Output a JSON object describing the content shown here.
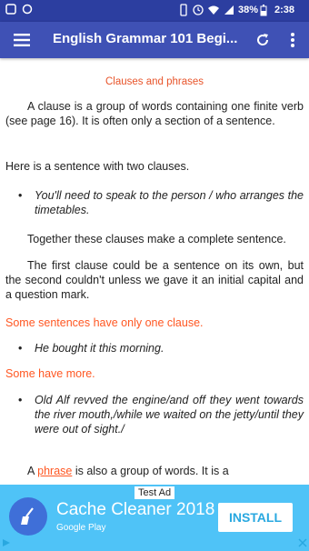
{
  "status_bar": {
    "battery": "38%",
    "time": "2:38"
  },
  "app_bar": {
    "title": "English Grammar 101 Begi..."
  },
  "content": {
    "heading": "Clauses and phrases",
    "para1": "A clause is a group of words containing one finite verb (see page 16). It is often only a section of a sentence.",
    "para2": "Here is a sentence with two clauses.",
    "bullet1": "You'll need to speak to the person / who arranges the timetables.",
    "para3": "Together these clauses make a complete sentence.",
    "para4": "The first clause could be a sentence on its own, but the second couldn't unless we gave it an initial capital and a question mark.",
    "note1": "Some sentences have only one clause.",
    "bullet2": "He bought it this morning.",
    "note2": "Some have more.",
    "bullet3": "Old Alf revved the engine/and off they went towards the river mouth,/while we waited on the jetty/until they were out of sight./",
    "para5_start": "A ",
    "para5_keyword": "phrase",
    "para5_rest": " is also a group of words. It is a"
  },
  "ad": {
    "label": "Test Ad",
    "app_name": "Cache Cleaner 2018",
    "store": "Google Play",
    "install_label": "INSTALL"
  }
}
